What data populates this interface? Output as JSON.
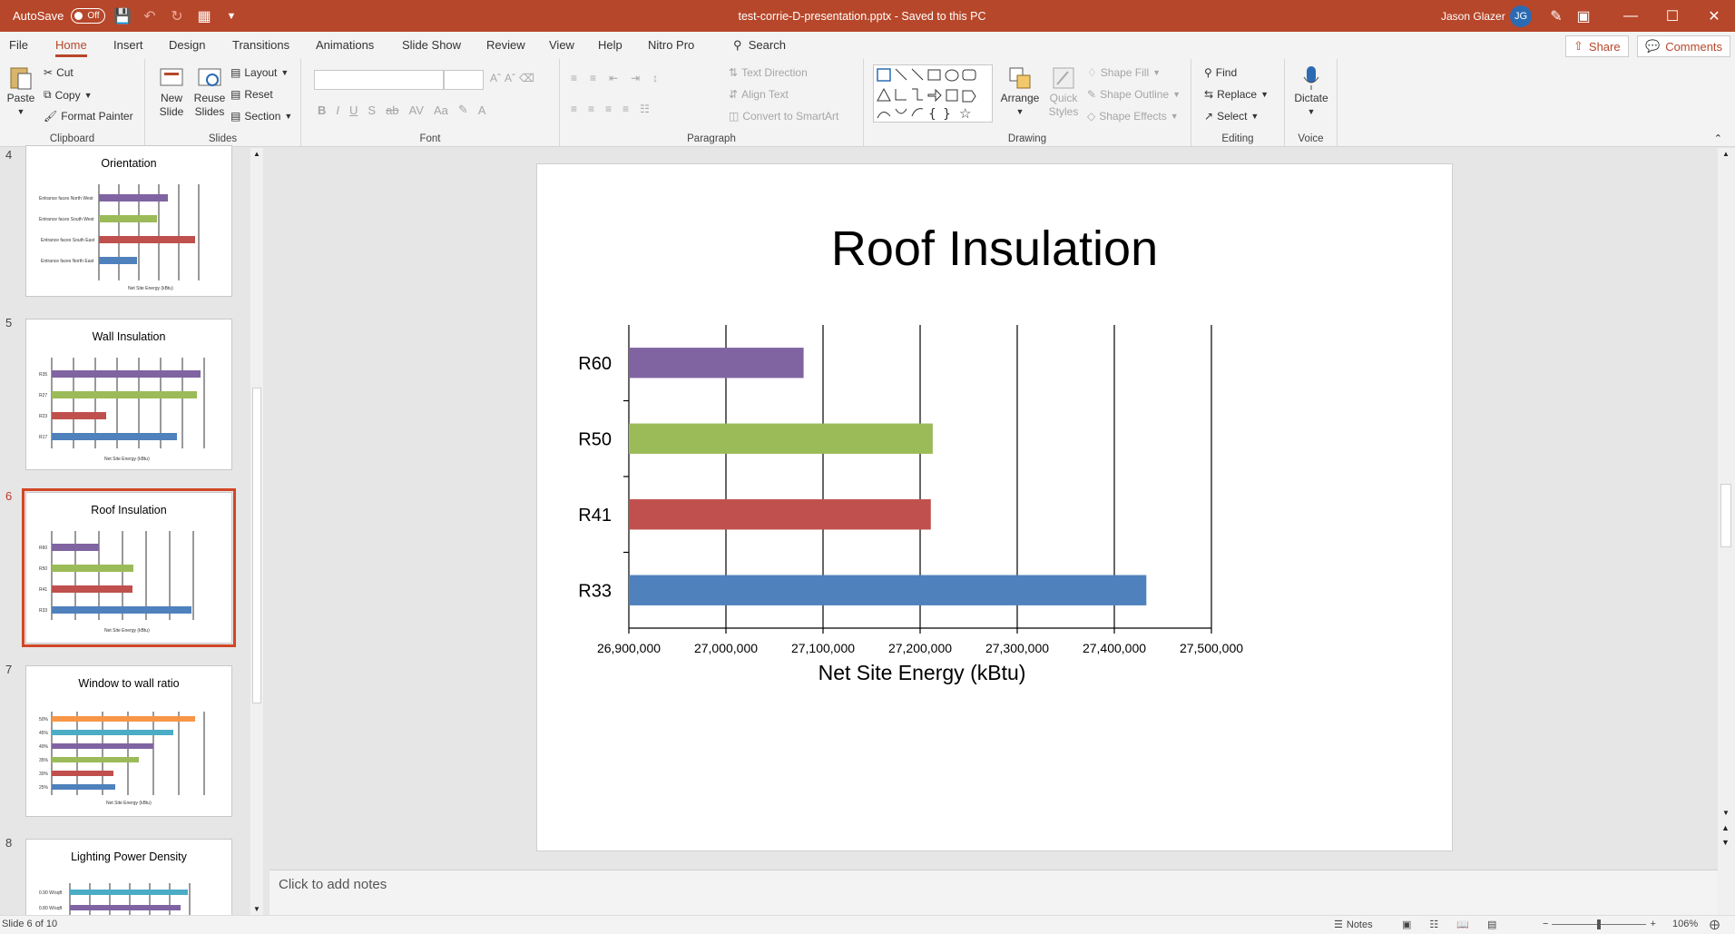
{
  "titlebar": {
    "autosave_label": "AutoSave",
    "autosave_state": "Off",
    "document_title": "test-corrie-D-presentation.pptx  -  Saved to this PC",
    "user_name": "Jason Glazer",
    "user_initials": "JG"
  },
  "menu": {
    "tabs": [
      "File",
      "Home",
      "Insert",
      "Design",
      "Transitions",
      "Animations",
      "Slide Show",
      "Review",
      "View",
      "Help",
      "Nitro Pro"
    ],
    "active_tab": "Home",
    "search_label": "Search",
    "share_label": "Share",
    "comments_label": "Comments"
  },
  "ribbon": {
    "clipboard": {
      "paste": "Paste",
      "cut": "Cut",
      "copy": "Copy",
      "format_painter": "Format Painter",
      "label": "Clipboard"
    },
    "slides": {
      "new_slide_1": "New",
      "new_slide_2": "Slide",
      "reuse_1": "Reuse",
      "reuse_2": "Slides",
      "layout": "Layout",
      "reset": "Reset",
      "section": "Section",
      "label": "Slides"
    },
    "font": {
      "label": "Font"
    },
    "paragraph": {
      "text_direction": "Text Direction",
      "align_text": "Align Text",
      "convert_smartart": "Convert to SmartArt",
      "label": "Paragraph"
    },
    "drawing": {
      "arrange": "Arrange",
      "quick_1": "Quick",
      "quick_2": "Styles",
      "shape_fill": "Shape Fill",
      "shape_outline": "Shape Outline",
      "shape_effects": "Shape Effects",
      "label": "Drawing"
    },
    "editing": {
      "find": "Find",
      "replace": "Replace",
      "select": "Select",
      "label": "Editing"
    },
    "voice": {
      "dictate": "Dictate",
      "label": "Voice"
    }
  },
  "thumbnails": [
    {
      "number": "4",
      "title": "Orientation"
    },
    {
      "number": "5",
      "title": "Wall Insulation"
    },
    {
      "number": "6",
      "title": "Roof Insulation",
      "active": true
    },
    {
      "number": "7",
      "title": "Window to wall ratio"
    },
    {
      "number": "8",
      "title": "Lighting Power Density"
    }
  ],
  "slide": {
    "title": "Roof Insulation"
  },
  "chart_data": {
    "type": "bar",
    "orientation": "horizontal",
    "categories": [
      "R60",
      "R50",
      "R41",
      "R33"
    ],
    "values": [
      27080000,
      27213000,
      27211000,
      27433000
    ],
    "colors": [
      "#8064a2",
      "#9bbb59",
      "#c0504d",
      "#4f81bd"
    ],
    "xlabel": "Net Site Energy (kBtu)",
    "xlim": [
      26900000,
      27500000
    ],
    "ticks": [
      "26,900,000",
      "27,000,000",
      "27,100,000",
      "27,200,000",
      "27,300,000",
      "27,400,000",
      "27,500,000"
    ],
    "grid": true
  },
  "notes": {
    "placeholder": "Click to add notes"
  },
  "status": {
    "slide_counter": "Slide 6 of 10",
    "notes_label": "Notes",
    "zoom": "106%"
  }
}
